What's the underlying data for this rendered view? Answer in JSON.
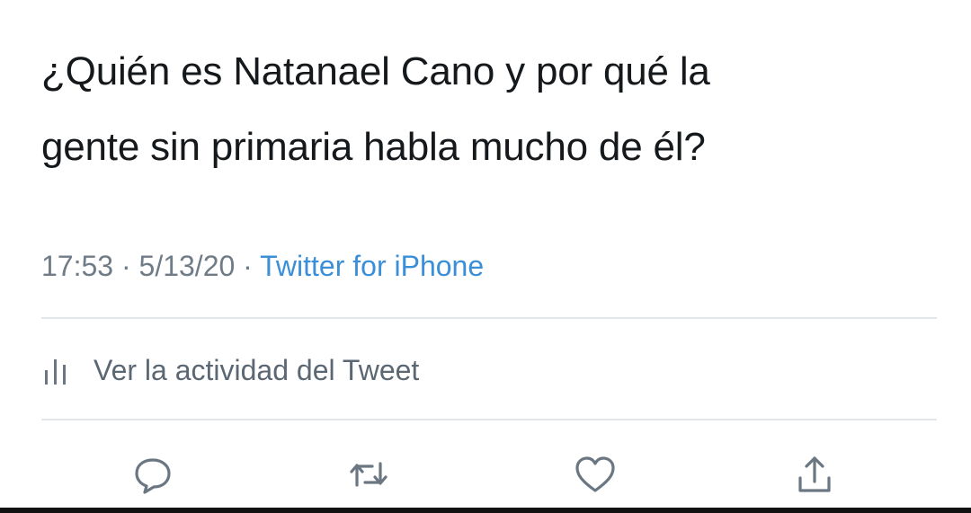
{
  "tweet": {
    "text": "¿Quién es Natanael Cano y por qué la\ngente sin primaria habla mucho de él?",
    "time": "17:53",
    "separator1": " · ",
    "date": "5/13/20",
    "separator2": " · ",
    "source": "Twitter for iPhone",
    "activity_label": "Ver la actividad del Tweet"
  },
  "icons": {
    "activity": "bar-chart-icon",
    "reply": "reply-icon",
    "retweet": "retweet-icon",
    "like": "heart-icon",
    "share": "share-icon"
  },
  "colors": {
    "text": "#16191c",
    "meta": "#6f7c88",
    "link": "#3a8fd8",
    "icon": "#6a7682",
    "divider": "#e3e7ea"
  }
}
